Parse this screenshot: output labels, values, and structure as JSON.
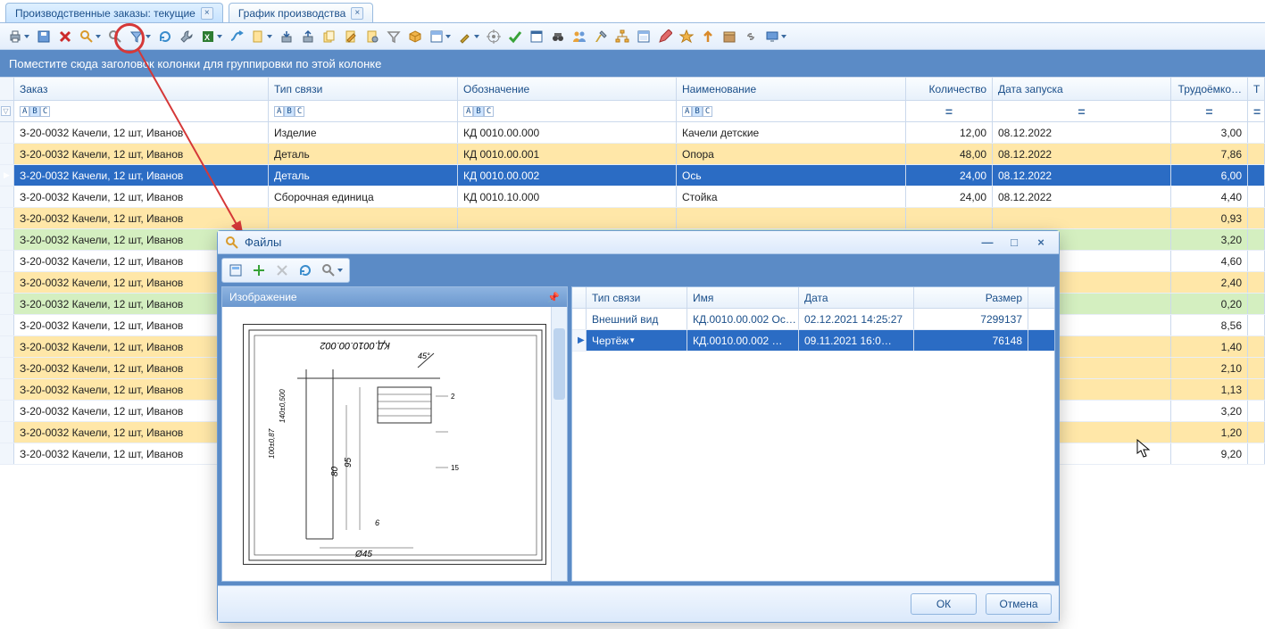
{
  "tabs": [
    {
      "label": "Производственные заказы: текущие",
      "active": true
    },
    {
      "label": "График производства",
      "active": false
    }
  ],
  "group_bar_text": "Поместите сюда заголовок колонки для группировки по этой колонке",
  "columns": {
    "order": "Заказ",
    "type": "Тип связи",
    "code": "Обозначение",
    "name": "Наименование",
    "qty": "Количество",
    "date": "Дата запуска",
    "labor": "Трудоёмко…",
    "rest": "Т"
  },
  "filter_placeholder": "",
  "filter_eq": "=",
  "rows": [
    {
      "cls": "white",
      "order": "З-20-0032 Качели, 12 шт, Иванов",
      "type": "Изделие",
      "code": "КД 0010.00.000",
      "name": "Качели детские",
      "qty": "12,00",
      "date": "08.12.2022",
      "lab": "3,00"
    },
    {
      "cls": "yellow",
      "order": "З-20-0032 Качели, 12 шт, Иванов",
      "type": "Деталь",
      "code": "КД 0010.00.001",
      "name": "Опора",
      "qty": "48,00",
      "date": "08.12.2022",
      "lab": "7,86"
    },
    {
      "cls": "selected",
      "order": "З-20-0032 Качели, 12 шт, Иванов",
      "type": "Деталь",
      "code": "КД 0010.00.002",
      "name": "Ось",
      "qty": "24,00",
      "date": "08.12.2022",
      "lab": "6,00",
      "ind": "▶"
    },
    {
      "cls": "white",
      "order": "З-20-0032 Качели, 12 шт, Иванов",
      "type": "Сборочная единица",
      "code": "КД 0010.10.000",
      "name": "Стойка",
      "qty": "24,00",
      "date": "08.12.2022",
      "lab": "4,40"
    },
    {
      "cls": "yellow",
      "order": "З-20-0032 Качели, 12 шт, Иванов",
      "type": "",
      "code": "",
      "name": "",
      "qty": "",
      "date": "",
      "lab": "0,93"
    },
    {
      "cls": "green",
      "order": "З-20-0032 Качели, 12 шт, Иванов",
      "type": "",
      "code": "",
      "name": "",
      "qty": "",
      "date": "",
      "lab": "3,20"
    },
    {
      "cls": "white",
      "order": "З-20-0032 Качели, 12 шт, Иванов",
      "type": "",
      "code": "",
      "name": "",
      "qty": "",
      "date": "",
      "lab": "4,60"
    },
    {
      "cls": "yellow",
      "order": "З-20-0032 Качели, 12 шт, Иванов",
      "type": "",
      "code": "",
      "name": "",
      "qty": "",
      "date": "",
      "lab": "2,40"
    },
    {
      "cls": "green",
      "order": "З-20-0032 Качели, 12 шт, Иванов",
      "type": "",
      "code": "",
      "name": "",
      "qty": "",
      "date": "",
      "lab": "0,20"
    },
    {
      "cls": "white",
      "order": "З-20-0032 Качели, 12 шт, Иванов",
      "type": "",
      "code": "",
      "name": "",
      "qty": "",
      "date": "",
      "lab": "8,56"
    },
    {
      "cls": "yellow",
      "order": "З-20-0032 Качели, 12 шт, Иванов",
      "type": "",
      "code": "",
      "name": "",
      "qty": "",
      "date": "",
      "lab": "1,40"
    },
    {
      "cls": "yellow",
      "order": "З-20-0032 Качели, 12 шт, Иванов",
      "type": "",
      "code": "",
      "name": "",
      "qty": "",
      "date": "",
      "lab": "2,10"
    },
    {
      "cls": "yellow",
      "order": "З-20-0032 Качели, 12 шт, Иванов",
      "type": "",
      "code": "",
      "name": "",
      "qty": "",
      "date": "",
      "lab": "1,13"
    },
    {
      "cls": "white",
      "order": "З-20-0032 Качели, 12 шт, Иванов",
      "type": "",
      "code": "",
      "name": "",
      "qty": "",
      "date": "",
      "lab": "3,20"
    },
    {
      "cls": "yellow",
      "order": "З-20-0032 Качели, 12 шт, Иванов",
      "type": "",
      "code": "",
      "name": "",
      "qty": "",
      "date": "",
      "lab": "1,20"
    },
    {
      "cls": "white",
      "order": "З-20-0032 Качели, 12 шт, Иванов",
      "type": "",
      "code": "",
      "name": "",
      "qty": "",
      "date": "",
      "lab": "9,20"
    }
  ],
  "dialog": {
    "title": "Файлы",
    "preview_header": "Изображение",
    "drawing_label": "КД.0010.00.002",
    "columns": {
      "type": "Тип связи",
      "name": "Имя",
      "date": "Дата",
      "size": "Размер"
    },
    "rows": [
      {
        "cls": "white",
        "type": "Внешний вид",
        "name": "КД.0010.00.002 Ос…",
        "date": "02.12.2021 14:25:27",
        "size": "7299137"
      },
      {
        "cls": "selected",
        "ind": "▶",
        "type": "Чертёж",
        "name": "КД.0010.00.002 …",
        "date": "09.11.2021 16:0…",
        "size": "76148"
      }
    ],
    "ok": "ОК",
    "cancel": "Отмена"
  },
  "toolbar_icons": [
    "print",
    "dropdown",
    "save",
    "delete-red",
    "files-magnifier",
    "dropdown",
    "search",
    "filter-funnel",
    "dropdown",
    "refresh",
    "wrench",
    "excel",
    "dropdown",
    "route",
    "page",
    "dropdown",
    "stack-in",
    "stack-out",
    "pages",
    "page-edit",
    "page-gear",
    "funnel",
    "cube",
    "template",
    "dropdown",
    "tool",
    "dropdown",
    "target",
    "check-green",
    "app",
    "binoculars",
    "users",
    "hammer",
    "diagram",
    "window",
    "pencil-edit",
    "star",
    "arrow-up",
    "box",
    "link",
    "screen",
    "dropdown"
  ]
}
